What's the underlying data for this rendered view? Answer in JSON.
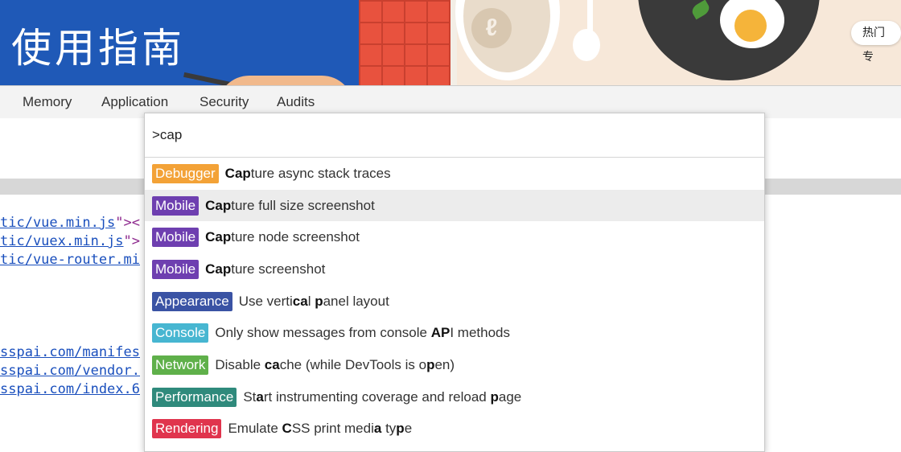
{
  "banner": {
    "title": "使用指南",
    "logo_glyph": "ℓ",
    "hot_pill": "热门专"
  },
  "devtools": {
    "tabs": [
      "Memory",
      "Application",
      "Security",
      "Audits"
    ]
  },
  "code": {
    "lines_top": [
      {
        "link": "tic/vue.min.js",
        "tail": "\"><"
      },
      {
        "link": "tic/vuex.min.js",
        "tail": "\">"
      },
      {
        "link": "tic/vue-router.mi",
        "tail": ""
      }
    ],
    "lines_bottom": [
      {
        "link": "sspai.com/manifes",
        "tail": ""
      },
      {
        "link": "sspai.com/vendor.",
        "tail": ""
      },
      {
        "link": "sspai.com/index.6",
        "tail": ""
      }
    ]
  },
  "palette": {
    "query": ">cap",
    "results": [
      {
        "badge": "Debugger",
        "color": "#f3a237",
        "parts": [
          {
            "t": "Cap",
            "b": true
          },
          {
            "t": "ture async stack traces",
            "b": false
          }
        ],
        "selected": false
      },
      {
        "badge": "Mobile",
        "color": "#6e3fb0",
        "parts": [
          {
            "t": "Cap",
            "b": true
          },
          {
            "t": "ture full size screenshot",
            "b": false
          }
        ],
        "selected": true
      },
      {
        "badge": "Mobile",
        "color": "#6e3fb0",
        "parts": [
          {
            "t": "Cap",
            "b": true
          },
          {
            "t": "ture node screenshot",
            "b": false
          }
        ],
        "selected": false
      },
      {
        "badge": "Mobile",
        "color": "#6e3fb0",
        "parts": [
          {
            "t": "Cap",
            "b": true
          },
          {
            "t": "ture screenshot",
            "b": false
          }
        ],
        "selected": false
      },
      {
        "badge": "Appearance",
        "color": "#3a53a4",
        "parts": [
          {
            "t": "Use verti",
            "b": false
          },
          {
            "t": "ca",
            "b": true
          },
          {
            "t": "l ",
            "b": false
          },
          {
            "t": "p",
            "b": true
          },
          {
            "t": "anel layout",
            "b": false
          }
        ],
        "selected": false
      },
      {
        "badge": "Console",
        "color": "#47b6d1",
        "parts": [
          {
            "t": "Only show messages from console ",
            "b": false
          },
          {
            "t": "AP",
            "b": true
          },
          {
            "t": "I methods",
            "b": false
          }
        ],
        "selected": false
      },
      {
        "badge": "Network",
        "color": "#5fb04a",
        "parts": [
          {
            "t": "Disable ",
            "b": false
          },
          {
            "t": "ca",
            "b": true
          },
          {
            "t": "che (while DevTools is o",
            "b": false
          },
          {
            "t": "p",
            "b": true
          },
          {
            "t": "en)",
            "b": false
          }
        ],
        "selected": false
      },
      {
        "badge": "Performance",
        "color": "#2f8a7c",
        "parts": [
          {
            "t": "St",
            "b": false
          },
          {
            "t": "a",
            "b": true
          },
          {
            "t": "rt instrumenting coverage and reload ",
            "b": false
          },
          {
            "t": "p",
            "b": true
          },
          {
            "t": "age",
            "b": false
          }
        ],
        "selected": false
      },
      {
        "badge": "Rendering",
        "color": "#e0344d",
        "parts": [
          {
            "t": "Emulate ",
            "b": false
          },
          {
            "t": "C",
            "b": true
          },
          {
            "t": "SS print medi",
            "b": false
          },
          {
            "t": "a",
            "b": true
          },
          {
            "t": " ty",
            "b": false
          },
          {
            "t": "p",
            "b": true
          },
          {
            "t": "e",
            "b": false
          }
        ],
        "selected": false
      }
    ]
  }
}
